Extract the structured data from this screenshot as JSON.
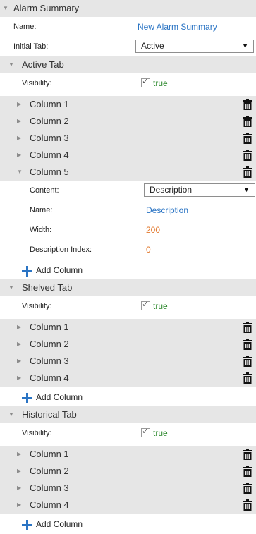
{
  "panel": {
    "title": "Alarm Summary"
  },
  "name_prop": {
    "label": "Name:",
    "value": "New Alarm Summary"
  },
  "initial_tab": {
    "label": "Initial Tab:",
    "value": "Active"
  },
  "active_tab": {
    "title": "Active Tab",
    "visibility": {
      "label": "Visibility:",
      "checked": true,
      "value": "true"
    },
    "columns": [
      "Column 1",
      "Column 2",
      "Column 3",
      "Column 4",
      "Column 5"
    ],
    "expanded_column": {
      "content": {
        "label": "Content:",
        "value": "Description"
      },
      "name": {
        "label": "Name:",
        "value": "Description"
      },
      "width": {
        "label": "Width:",
        "value": "200"
      },
      "description_index": {
        "label": "Description Index:",
        "value": "0"
      }
    },
    "add_label": "Add Column"
  },
  "shelved_tab": {
    "title": "Shelved Tab",
    "visibility": {
      "label": "Visibility:",
      "checked": true,
      "value": "true"
    },
    "columns": [
      "Column 1",
      "Column 2",
      "Column 3",
      "Column 4"
    ],
    "add_label": "Add Column"
  },
  "historical_tab": {
    "title": "Historical Tab",
    "visibility": {
      "label": "Visibility:",
      "checked": true,
      "value": "true"
    },
    "columns": [
      "Column 1",
      "Column 2",
      "Column 3",
      "Column 4"
    ],
    "add_label": "Add Column"
  },
  "icons": {
    "expanded": "triangle-down-icon",
    "collapsed": "triangle-right-icon",
    "delete": "trash-icon",
    "add": "plus-icon",
    "dropdown": "caret-down-icon"
  },
  "colors": {
    "link": "#2a74c4",
    "number": "#e2772b",
    "boolean": "#2f8a2f",
    "header_bg": "#e6e6e6"
  }
}
